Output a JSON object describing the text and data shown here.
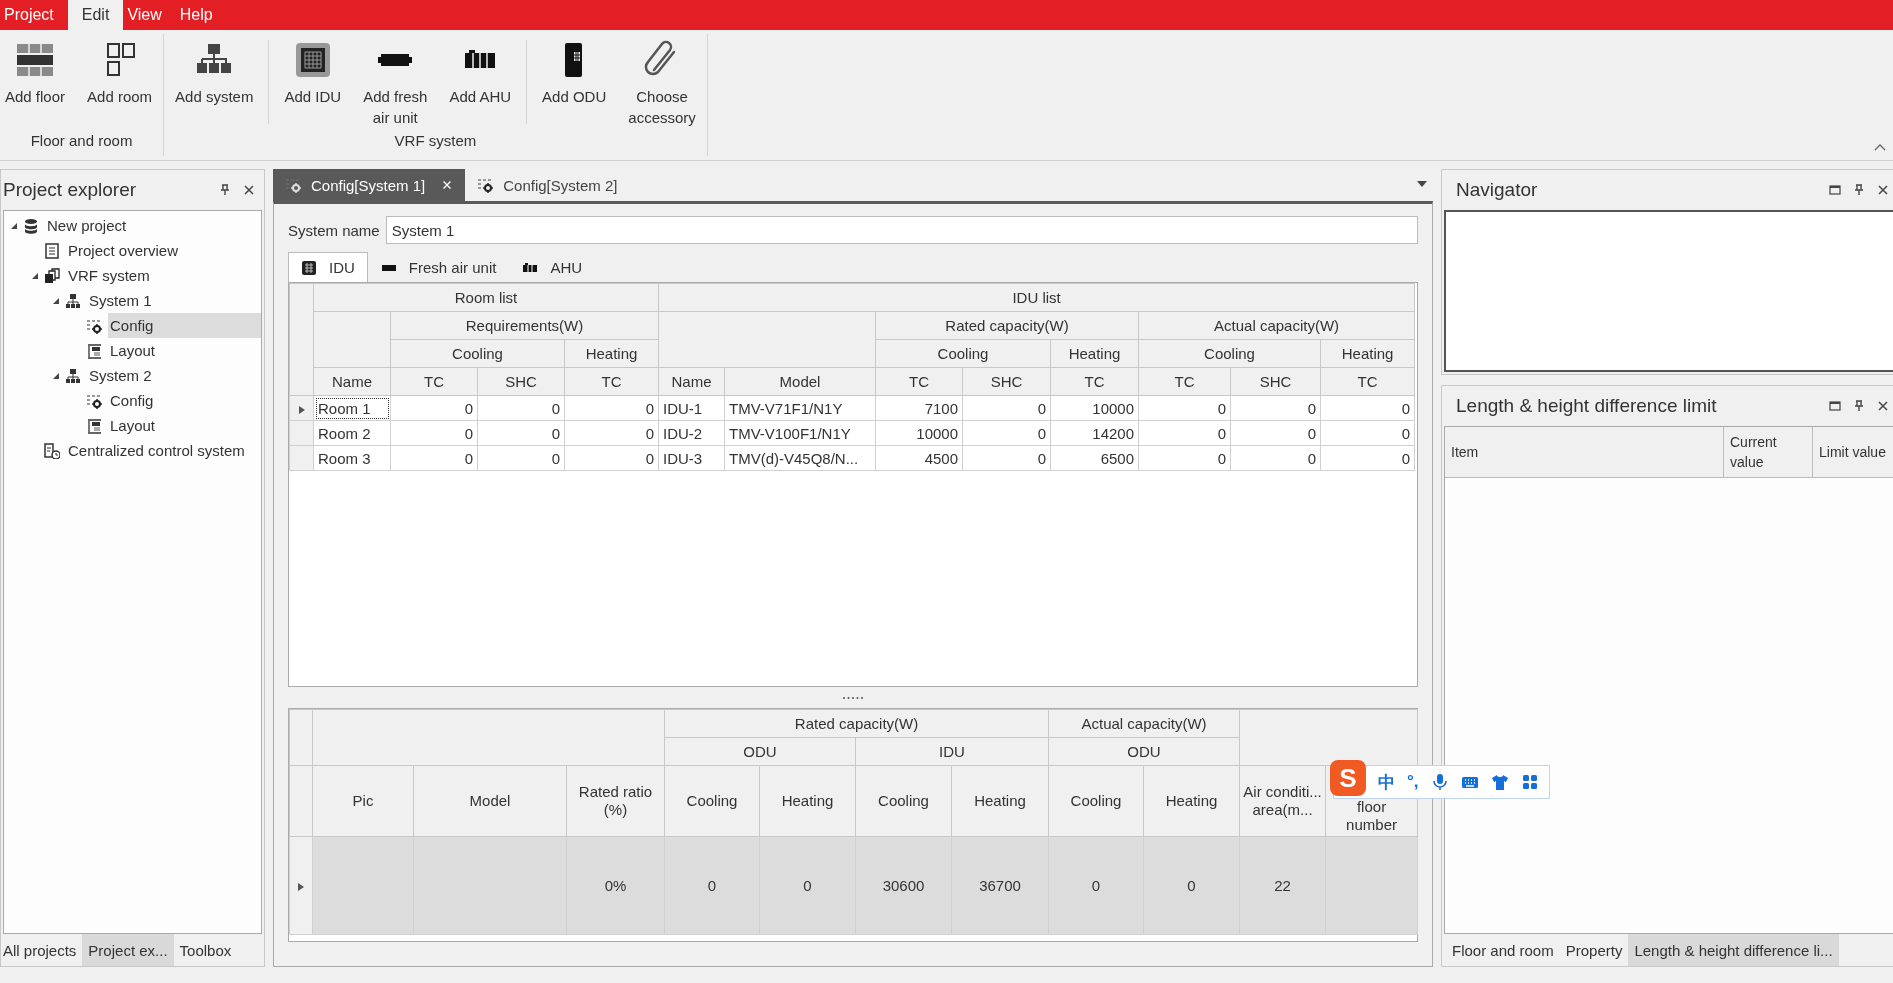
{
  "menu": [
    {
      "label": "Project",
      "selected": false
    },
    {
      "label": "Edit",
      "selected": true
    },
    {
      "label": "View",
      "selected": false
    },
    {
      "label": "Help",
      "selected": false
    }
  ],
  "ribbon": {
    "groups": [
      {
        "label": "Floor and room",
        "sections": [
          [
            {
              "kind": "floor",
              "label": "Add floor"
            },
            {
              "kind": "room",
              "label": "Add room"
            }
          ]
        ]
      },
      {
        "label": "VRF system",
        "sections": [
          [
            {
              "kind": "system",
              "label": "Add system"
            }
          ],
          [
            {
              "kind": "idu",
              "label": "Add IDU"
            },
            {
              "kind": "fresh",
              "label": "Add fresh\nair unit"
            },
            {
              "kind": "ahu",
              "label": "Add AHU"
            }
          ],
          [
            {
              "kind": "odu",
              "label": "Add ODU"
            },
            {
              "kind": "clip",
              "label": "Choose\naccessory"
            }
          ]
        ]
      }
    ]
  },
  "project_explorer": {
    "title": "Project explorer",
    "tree": [
      {
        "kind": "database",
        "label": "New project",
        "expanded": true,
        "selected": false,
        "children": [
          {
            "kind": "document",
            "label": "Project overview",
            "selected": false
          },
          {
            "kind": "vrf",
            "label": "VRF system",
            "expanded": true,
            "selected": false,
            "children": [
              {
                "kind": "system",
                "label": "System 1",
                "expanded": true,
                "selected": false,
                "children": [
                  {
                    "kind": "config",
                    "label": "Config",
                    "selected": true
                  },
                  {
                    "kind": "layout",
                    "label": "Layout",
                    "selected": false
                  }
                ]
              },
              {
                "kind": "system",
                "label": "System 2",
                "expanded": true,
                "selected": false,
                "children": [
                  {
                    "kind": "config",
                    "label": "Config",
                    "selected": false
                  },
                  {
                    "kind": "layout",
                    "label": "Layout",
                    "selected": false
                  }
                ]
              }
            ]
          },
          {
            "kind": "clock",
            "label": "Centralized control system",
            "selected": false
          }
        ]
      }
    ],
    "tabs": [
      {
        "label": "All projects",
        "selected": false
      },
      {
        "label": "Project ex...",
        "selected": true
      },
      {
        "label": "Toolbox",
        "selected": false
      }
    ]
  },
  "documents": {
    "tabs": [
      {
        "label": "Config[System 1]",
        "selected": true
      },
      {
        "label": "Config[System 2]",
        "selected": false
      }
    ],
    "system_name": {
      "label": "System name",
      "value": "System 1"
    },
    "unit_tabs": [
      {
        "kind": "idu",
        "label": "IDU",
        "selected": true
      },
      {
        "kind": "fresh",
        "label": "Fresh air unit",
        "selected": false
      },
      {
        "kind": "ahu",
        "label": "AHU",
        "selected": false
      }
    ],
    "idu_grid": {
      "headers": {
        "room_list": "Room list",
        "idu_list": "IDU list",
        "requirements": "Requirements(W)",
        "rated_capacity": "Rated capacity(W)",
        "actual_capacity": "Actual capacity(W)",
        "req_cooling": "Cooling",
        "req_heating": "Heating",
        "rated_cooling": "Cooling",
        "rated_heating": "Heating",
        "actual_cooling": "Cooling",
        "actual_heating": "Heating"
      },
      "columns": [
        "Name",
        "TC",
        "SHC",
        "TC",
        "Name",
        "Model",
        "TC",
        "SHC",
        "TC",
        "TC",
        "SHC",
        "TC"
      ],
      "rows": [
        {
          "current": true,
          "cells": [
            "Room 1",
            "0",
            "0",
            "0",
            "IDU-1",
            "TMV-V71F1/N1Y",
            "7100",
            "0",
            "10000",
            "0",
            "0",
            "0"
          ]
        },
        {
          "current": false,
          "cells": [
            "Room 2",
            "0",
            "0",
            "0",
            "IDU-2",
            "TMV-V100F1/N1Y",
            "10000",
            "0",
            "14200",
            "0",
            "0",
            "0"
          ]
        },
        {
          "current": false,
          "cells": [
            "Room 3",
            "0",
            "0",
            "0",
            "IDU-3",
            "TMV(d)-V45Q8/N...",
            "4500",
            "0",
            "6500",
            "0",
            "0",
            "0"
          ]
        }
      ]
    },
    "odu_grid": {
      "headers": {
        "rated_capacity": "Rated capacity(W)",
        "actual_capacity": "Actual capacity(W)",
        "rated_odu": "ODU",
        "rated_idu": "IDU",
        "actual_odu": "ODU"
      },
      "columns": [
        "Pic",
        "Model",
        "Rated ratio (%)",
        "Cooling",
        "Heating",
        "Cooling",
        "Heating",
        "Cooling",
        "Heating",
        "Air conditi...\narea(m...",
        "floor\nnumber"
      ],
      "rows": [
        {
          "current": true,
          "selected": true,
          "cells": {
            "rated_ratio": "0%",
            "rated_odu_cooling": "0",
            "rated_odu_heating": "0",
            "rated_idu_cooling": "30600",
            "rated_idu_heating": "36700",
            "actual_odu_cooling": "0",
            "actual_odu_heating": "0",
            "area": "22"
          }
        }
      ]
    }
  },
  "navigator": {
    "title": "Navigator"
  },
  "limits": {
    "title": "Length & height difference limit",
    "columns": [
      "Item",
      "Current\nvalue",
      "Limit value"
    ]
  },
  "right_tabs": [
    {
      "label": "Floor and room",
      "selected": false
    },
    {
      "label": "Property",
      "selected": false
    },
    {
      "label": "Length & height difference li...",
      "selected": true
    }
  ],
  "ime_toolbar": {
    "logo": "S",
    "mode": "中",
    "punctuation": "°,"
  }
}
